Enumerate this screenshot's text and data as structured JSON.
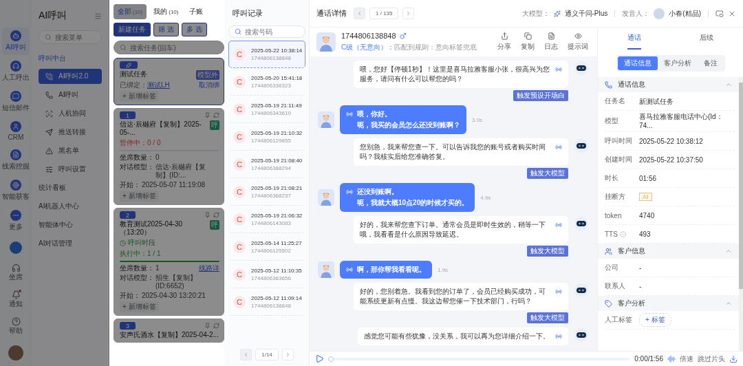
{
  "rail": {
    "items": [
      {
        "label": "AI呼叫",
        "selected": true
      },
      {
        "label": "人工呼出",
        "selected": false
      },
      {
        "label": "短信邮件",
        "selected": false
      },
      {
        "label": "CRM",
        "selected": false
      },
      {
        "label": "线索挖掘",
        "selected": false
      },
      {
        "label": "智能获客",
        "selected": false
      },
      {
        "label": "更多",
        "selected": false
      }
    ],
    "bottom": [
      {
        "label": "坐席",
        "dot": false
      },
      {
        "label": "通知",
        "dot": true
      },
      {
        "label": "帮助",
        "dot": false
      }
    ]
  },
  "nav": {
    "title": "AI呼叫",
    "search_placeholder": "搜索菜单",
    "group": "呼叫中台",
    "items": [
      {
        "label": "AI呼叫2.0",
        "selected": true
      },
      {
        "label": "AI呼叫",
        "selected": false
      },
      {
        "label": "人机协同",
        "selected": false
      },
      {
        "label": "推送转接",
        "selected": false
      },
      {
        "label": "黑名单",
        "selected": false
      },
      {
        "label": "呼叫设置",
        "selected": false
      }
    ],
    "links": [
      "统计看板",
      "AI机器人中心",
      "智能体中心",
      "AI对话管理"
    ]
  },
  "tasks": {
    "tabs": [
      {
        "label": "全部",
        "count": "(10)",
        "selected": true
      },
      {
        "label": "我的",
        "count": "(10)",
        "selected": false
      },
      {
        "label": "子账",
        "selected": false
      }
    ],
    "buttons": [
      {
        "label": "新建任务",
        "primary": true
      },
      {
        "label": "筛 选",
        "primary": false
      },
      {
        "label": "多 选",
        "primary": false
      }
    ],
    "search_placeholder": "搜索任务(回车)",
    "cards": [
      {
        "kind": "template",
        "title": "测试任务",
        "tag": "模型外",
        "bound_label": "已绑定：",
        "bound_link": "测试LH",
        "bound_action": "取消绑",
        "add_tag": "+ 新增标签"
      },
      {
        "kind": "task",
        "badge": "1",
        "title": "信达·辰樾府【复制】2025-05-...",
        "tag": "呼",
        "status": {
          "text": "暂停中：0 / 0",
          "kind": "paused"
        },
        "level": 0,
        "fields": [
          {
            "label": "坐席数量：",
            "value": "0"
          },
          {
            "label": "对话模型：",
            "value": "信达·辰樾府【复制】(ID:..."
          },
          {
            "label": "开始：",
            "value": "2025-05-07 11:19:08"
          }
        ],
        "add_tag": "+ 新增标签"
      },
      {
        "kind": "task",
        "badge": "2",
        "title": "教育测试2025-04-30（13:20）",
        "tag": "呼",
        "schedule": "呼叫时段",
        "status": {
          "text": "执行中：1 / 1",
          "kind": "running"
        },
        "level": 1,
        "fields": [
          {
            "label": "坐席数量：",
            "value": "1",
            "link": "线路详"
          },
          {
            "label": "对话模型：",
            "value": "招生【复制】(ID:6652)"
          },
          {
            "label": "开始：",
            "value": "2025-04-30 13:20:21"
          }
        ],
        "add_tag": "+ 新增标签"
      },
      {
        "kind": "task",
        "badge": "3",
        "title": "安声氏酒水【复制】2025-04-2..."
      }
    ]
  },
  "records": {
    "title": "呼叫记录",
    "search_placeholder": "搜索号码",
    "items": [
      {
        "letter": "C",
        "time": "2025-05-22 10:38:14",
        "number": "1744806138848",
        "selected": true
      },
      {
        "letter": "C",
        "time": "2025-05-20 15:41:18",
        "number": "1744806338323",
        "selected": false
      },
      {
        "letter": "C",
        "time": "2025-05-19 21:11:49",
        "number": "1744806343610",
        "selected": false
      },
      {
        "letter": "C",
        "time": "2025-05-19 21:10:32",
        "number": "1744806129855",
        "selected": false
      },
      {
        "letter": "C",
        "time": "2025-05-19 21:08:40",
        "number": "1744806388294",
        "selected": false
      },
      {
        "letter": "C",
        "time": "2025-05-19 21:08:21",
        "number": "1744806368237",
        "selected": false
      },
      {
        "letter": "C",
        "time": "2025-05-19 21:06:32",
        "number": "1744806143083",
        "selected": false
      },
      {
        "letter": "C",
        "time": "2025-05-14 11:25:27",
        "number": "1744806125502",
        "selected": false
      },
      {
        "letter": "C",
        "time": "2025-05-12 11:10:35",
        "number": "1744806363656",
        "selected": false
      },
      {
        "letter": "C",
        "time": "2025-05-12 11:09:14",
        "number": "1744806138848",
        "selected": false
      }
    ],
    "pager": "1/14"
  },
  "header": {
    "title": "通话详情",
    "pager": "1 / 135",
    "model_label": "大模型：",
    "model": "通义千问-Plus",
    "voice_label": "发音人：",
    "voice": "小春(精品)"
  },
  "customer": {
    "number": "1744806138848",
    "grade": "C级（无意向）：",
    "rule": "匹配到规则：意向标签兜底",
    "actions": [
      {
        "kind": "share",
        "label": "分享"
      },
      {
        "kind": "copy",
        "label": "复制"
      },
      {
        "kind": "log",
        "label": "日志"
      },
      {
        "kind": "prompt",
        "label": "提示词"
      }
    ]
  },
  "messages": [
    {
      "kind": "bot",
      "text": "喂，您好【停顿1秒】！这里是喜马拉雅客服小张，很高兴为您服务，请问有什么可以帮您的吗？",
      "tag": "触发预设开场白"
    },
    {
      "kind": "user",
      "lines": [
        "喂，你好。",
        "呃，我买的会员怎么还没到账啊？"
      ],
      "duration": "3.0s"
    },
    {
      "kind": "bot",
      "text": "您别急，我来帮您查一下。可以告诉我您的账号或者购买时间吗？我核实后给您准确答复。",
      "tag": "触发大模型"
    },
    {
      "kind": "user",
      "lines": [
        "还没到账啊。",
        "呃，我就大概10点20的时候才买的。"
      ],
      "duration": "4.9s"
    },
    {
      "kind": "bot",
      "text": "好的，我来帮您查下订单。通常会员是即时生效的，稍等一下哦，我看看是什么原因导致延迟。",
      "tag": "触发大模型"
    },
    {
      "kind": "user",
      "lines": [
        "啊，那你帮我看看呢。"
      ],
      "duration": "1.9s"
    },
    {
      "kind": "bot",
      "text": "好的，您别着急。我看到您的订单了，会员已经购买成功，可能系统更新有点慢。我这边帮您催一下技术部门，行吗？",
      "tag": "触发大模型"
    },
    {
      "kind": "bot",
      "text": "感觉您可能有些犹豫，没关系，我可以再为您详细介绍一下。"
    }
  ],
  "player": {
    "level": 0,
    "time": "0:00/1:56",
    "speed": "倍速",
    "skip": "跳过片头"
  },
  "side": {
    "tabs": [
      {
        "label": "通话",
        "selected": true
      },
      {
        "label": "后续",
        "selected": false
      }
    ],
    "segments": [
      {
        "label": "通话信息",
        "selected": true
      },
      {
        "label": "客户分析",
        "selected": false
      },
      {
        "label": "备注",
        "selected": false
      }
    ],
    "sections": [
      {
        "kind": "call",
        "title": "通话信息",
        "rows": [
          {
            "label": "任务名",
            "value": "新测试任务"
          },
          {
            "label": "模型",
            "value": "喜马拉雅客服电话中心(Id：74..."
          },
          {
            "label": "呼叫时间",
            "value": "2025-05-22 10:38:12"
          },
          {
            "label": "创建时间",
            "value": "2025-05-22 10:37:50"
          },
          {
            "label": "时长",
            "value": "01:56"
          },
          {
            "label": "挂断方",
            "value": "AI",
            "kind": "tag"
          },
          {
            "label": "token",
            "value": "4740"
          },
          {
            "label": "TTS",
            "value": "493",
            "info": true
          }
        ]
      },
      {
        "kind": "customer",
        "title": "客户信息",
        "rows": [
          {
            "label": "公司",
            "value": "-"
          },
          {
            "label": "联系人",
            "value": "-"
          }
        ]
      },
      {
        "kind": "analysis",
        "title": "客户分析",
        "rows": [
          {
            "label": "人工标签",
            "value": "+ 标签",
            "kind": "button"
          }
        ]
      }
    ]
  }
}
